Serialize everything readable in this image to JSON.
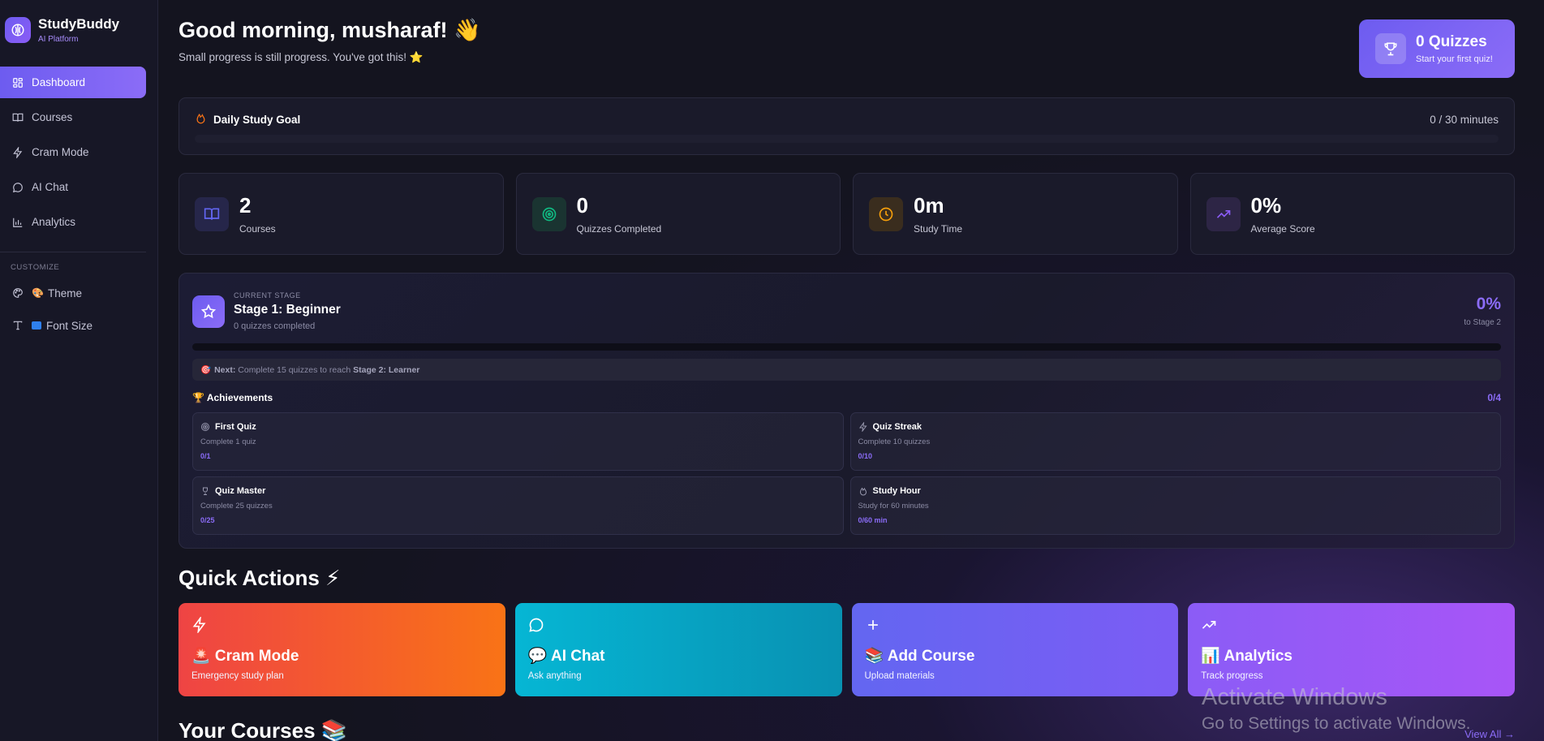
{
  "brand": {
    "name": "StudyBuddy",
    "subtitle": "AI Platform"
  },
  "sidebar": {
    "items": [
      {
        "label": "Dashboard",
        "icon": "grid-icon",
        "active": true
      },
      {
        "label": "Courses",
        "icon": "book-icon"
      },
      {
        "label": "Cram Mode",
        "icon": "lightning-icon"
      },
      {
        "label": "AI Chat",
        "icon": "chat-icon"
      },
      {
        "label": "Analytics",
        "icon": "bar-chart-icon"
      }
    ],
    "customize_title": "CUSTOMIZE",
    "customize": [
      {
        "label": "Theme",
        "emoji": "🎨",
        "icon": "palette-icon"
      },
      {
        "label": "Font Size",
        "icon": "text-icon"
      }
    ]
  },
  "header": {
    "greeting": "Good morning, musharaf! 👋",
    "subtitle": "Small progress is still progress. You've got this!",
    "star": "⭐"
  },
  "quiz_badge": {
    "title": "0 Quizzes",
    "subtitle": "Start your first quiz!"
  },
  "goal": {
    "title": "Daily Study Goal",
    "value": "0 / 30 minutes",
    "progress": 0
  },
  "stats": [
    {
      "value": "2",
      "label": "Courses",
      "icon": "book-icon",
      "color": "#6366f1"
    },
    {
      "value": "0",
      "label": "Quizzes Completed",
      "icon": "target-icon",
      "color": "#10b981"
    },
    {
      "value": "0m",
      "label": "Study Time",
      "icon": "clock-icon",
      "color": "#f59e0b"
    },
    {
      "value": "0%",
      "label": "Average Score",
      "icon": "trending-up-icon",
      "color": "#8b5cf6"
    }
  ],
  "stage": {
    "caption": "CURRENT STAGE",
    "name": "Stage 1: Beginner",
    "sub": "0 quizzes completed",
    "percent": "0%",
    "to": "to Stage 2",
    "progress": 0,
    "next_emoji": "🎯",
    "next_label": "Next:",
    "next_text": "Complete 15 quizzes to reach",
    "next_target": "Stage 2: Learner"
  },
  "achievements": {
    "title": "Achievements",
    "emoji": "🏆",
    "count": "0/4",
    "items": [
      {
        "name": "First Quiz",
        "desc": "Complete 1 quiz",
        "progress": "0/1",
        "icon": "target-icon"
      },
      {
        "name": "Quiz Streak",
        "desc": "Complete 10 quizzes",
        "progress": "0/10",
        "icon": "lightning-icon"
      },
      {
        "name": "Quiz Master",
        "desc": "Complete 25 quizzes",
        "progress": "0/25",
        "icon": "trophy-icon"
      },
      {
        "name": "Study Hour",
        "desc": "Study for 60 minutes",
        "progress": "0/60 min",
        "icon": "flame-icon"
      }
    ]
  },
  "quick_actions": {
    "title": "Quick Actions ⚡",
    "items": [
      {
        "name": "🚨 Cram Mode",
        "desc": "Emergency study plan",
        "icon": "lightning-icon"
      },
      {
        "name": "💬 AI Chat",
        "desc": "Ask anything",
        "icon": "chat-icon"
      },
      {
        "name": "📚 Add Course",
        "desc": "Upload materials",
        "icon": "plus-icon"
      },
      {
        "name": "📊 Analytics",
        "desc": "Track progress",
        "icon": "trending-up-icon"
      }
    ]
  },
  "courses": {
    "title": "Your Courses 📚",
    "view_all": "View All →"
  },
  "watermark": {
    "line1": "Activate Windows",
    "line2": "Go to Settings to activate Windows."
  }
}
